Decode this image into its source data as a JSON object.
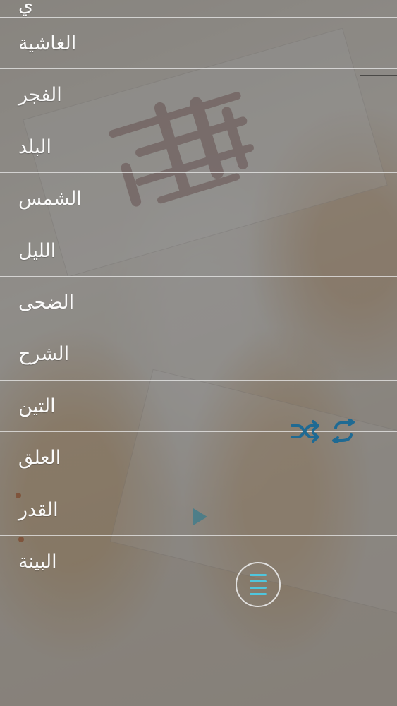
{
  "surah_list": [
    {
      "label": "ي"
    },
    {
      "label": "الغاشية"
    },
    {
      "label": "الفجر"
    },
    {
      "label": "البلد"
    },
    {
      "label": "الشمس"
    },
    {
      "label": "الليل"
    },
    {
      "label": "الضحى"
    },
    {
      "label": "الشرح"
    },
    {
      "label": "التين"
    },
    {
      "label": "العلق"
    },
    {
      "label": "القدر"
    },
    {
      "label": "البينة"
    }
  ],
  "controls": {
    "shuffle_icon": "shuffle-icon",
    "repeat_icon": "repeat-icon",
    "play_icon": "play-icon",
    "menu_icon": "menu-icon",
    "accent_color": "#1f6a93",
    "menu_color": "#4fc6de"
  },
  "background": {
    "overlay_color": "#4a4a4a"
  }
}
